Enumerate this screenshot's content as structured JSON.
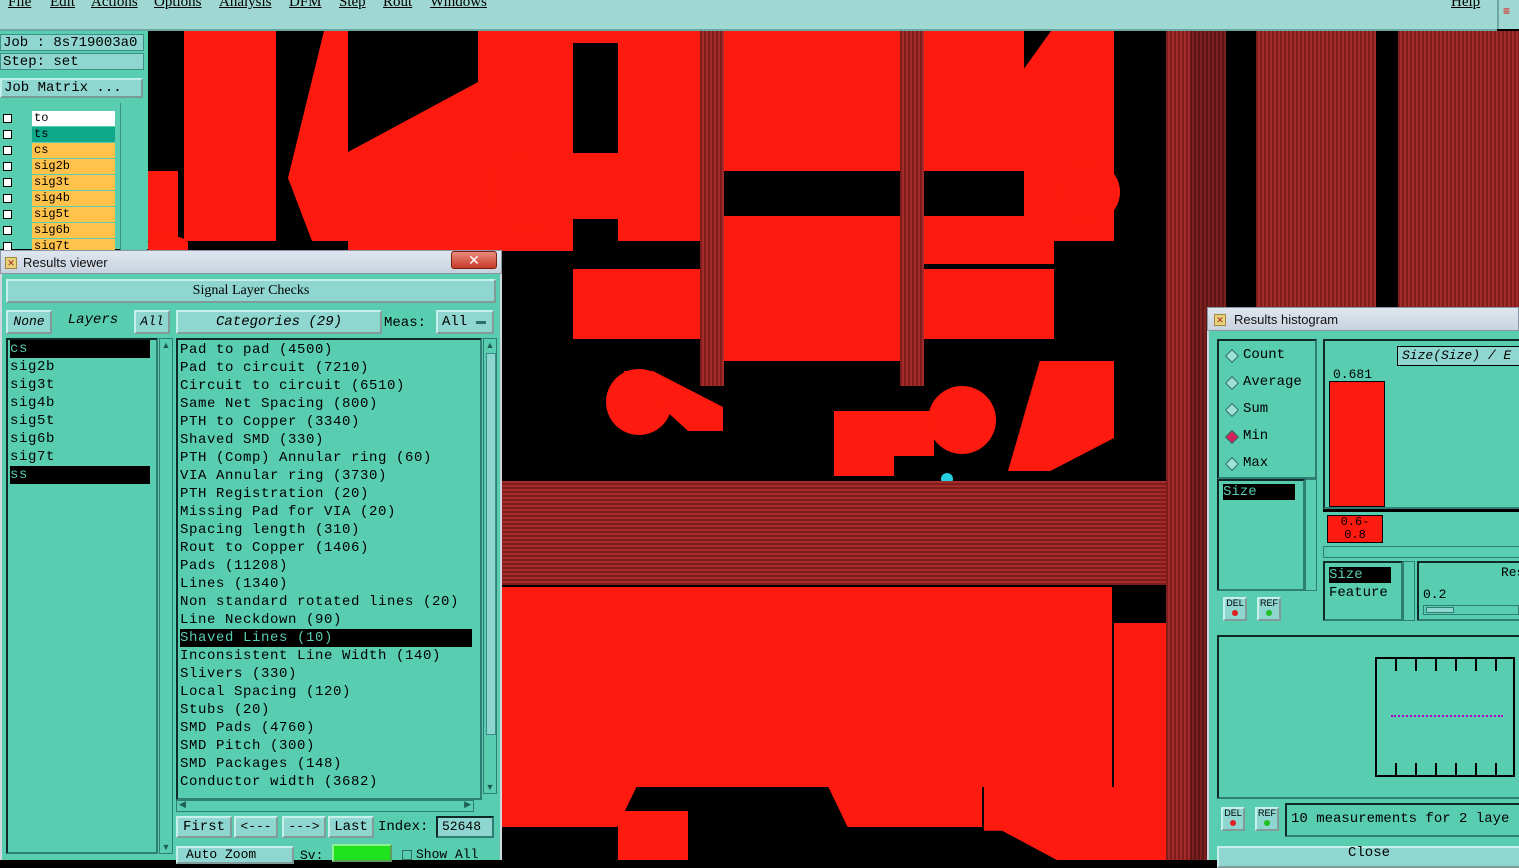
{
  "menubar": {
    "items": [
      "File",
      "Edit",
      "Actions",
      "Options",
      "Analysis",
      "DFM",
      "Step",
      "Rout",
      "Windows"
    ],
    "help": "Help"
  },
  "job": {
    "job_label": "Job : 8s719003a0",
    "step_label": "Step: set",
    "matrix_button": "Job Matrix ...",
    "layers": [
      {
        "name": "to",
        "color": "#ffffff"
      },
      {
        "name": "ts",
        "color": "#0ea88a"
      },
      {
        "name": "cs",
        "color": "#ffc24a"
      },
      {
        "name": "sig2b",
        "color": "#ffc24a"
      },
      {
        "name": "sig3t",
        "color": "#ffc24a"
      },
      {
        "name": "sig4b",
        "color": "#ffc24a"
      },
      {
        "name": "sig5t",
        "color": "#ffc24a"
      },
      {
        "name": "sig6b",
        "color": "#ffc24a"
      },
      {
        "name": "sig7t",
        "color": "#ffc24a"
      }
    ]
  },
  "results_viewer": {
    "title": "Results viewer",
    "close": "✕",
    "header": "Signal Layer Checks",
    "btn_none": "None",
    "btn_layers": "Layers",
    "btn_all": "All",
    "categories_button": "Categories (29)",
    "meas_label": "Meas:",
    "meas_value": "All",
    "layers": [
      "cs",
      "sig2b",
      "sig3t",
      "sig4b",
      "sig5t",
      "sig6b",
      "sig7t",
      "ss"
    ],
    "selected_layers": [
      0,
      7
    ],
    "categories": [
      "Pad to pad (4500)",
      "Pad to circuit (7210)",
      "Circuit to circuit (6510)",
      "Same Net Spacing (800)",
      "PTH to Copper (3340)",
      "Shaved SMD (330)",
      "PTH (Comp) Annular ring (60)",
      "VIA Annular ring (3730)",
      "PTH Registration (20)",
      "Missing Pad for VIA (20)",
      "Spacing length (310)",
      "Rout to Copper (1406)",
      "Pads (11208)",
      "Lines (1340)",
      "Non standard rotated lines (20)",
      "Line Neckdown (90)",
      "Shaved Lines (10)",
      "Inconsistent Line Width (140)",
      "Slivers (330)",
      "Local Spacing (120)",
      "Stubs (20)",
      "SMD Pads (4760)",
      "SMD Pitch (300)",
      "SMD Packages (148)",
      "Conductor width (3682)"
    ],
    "selected_category": 16,
    "nav": {
      "first": "First",
      "prev": "<---",
      "next": "--->",
      "last": "Last",
      "index_label": "Index:",
      "index_value": "52648"
    },
    "auto_zoom": "Auto Zoom",
    "sv_label": "Sv:",
    "show_all": "Show All"
  },
  "histogram": {
    "title": "Results histogram",
    "options": [
      "Count",
      "Average",
      "Sum",
      "Min",
      "Max"
    ],
    "selected_option": "Min",
    "list_item": "Size",
    "chart_title": "Size(Size) / E",
    "bar_value_label": "0.681",
    "bar_fraction": 1.0,
    "bin_label": "0.6-\n0.8",
    "field_size": "Size",
    "field_feature": "Feature",
    "res_label": "Res",
    "slider_value": "0.2",
    "del": "DEL",
    "ref": "REF",
    "status": "10 measurements for 2 laye",
    "close": "Close"
  },
  "colors": {
    "panel": "#58cdb0",
    "menubar": "#9fd8d2",
    "copper": "#ff1a0f",
    "dark_copper": "#a52a2a"
  }
}
